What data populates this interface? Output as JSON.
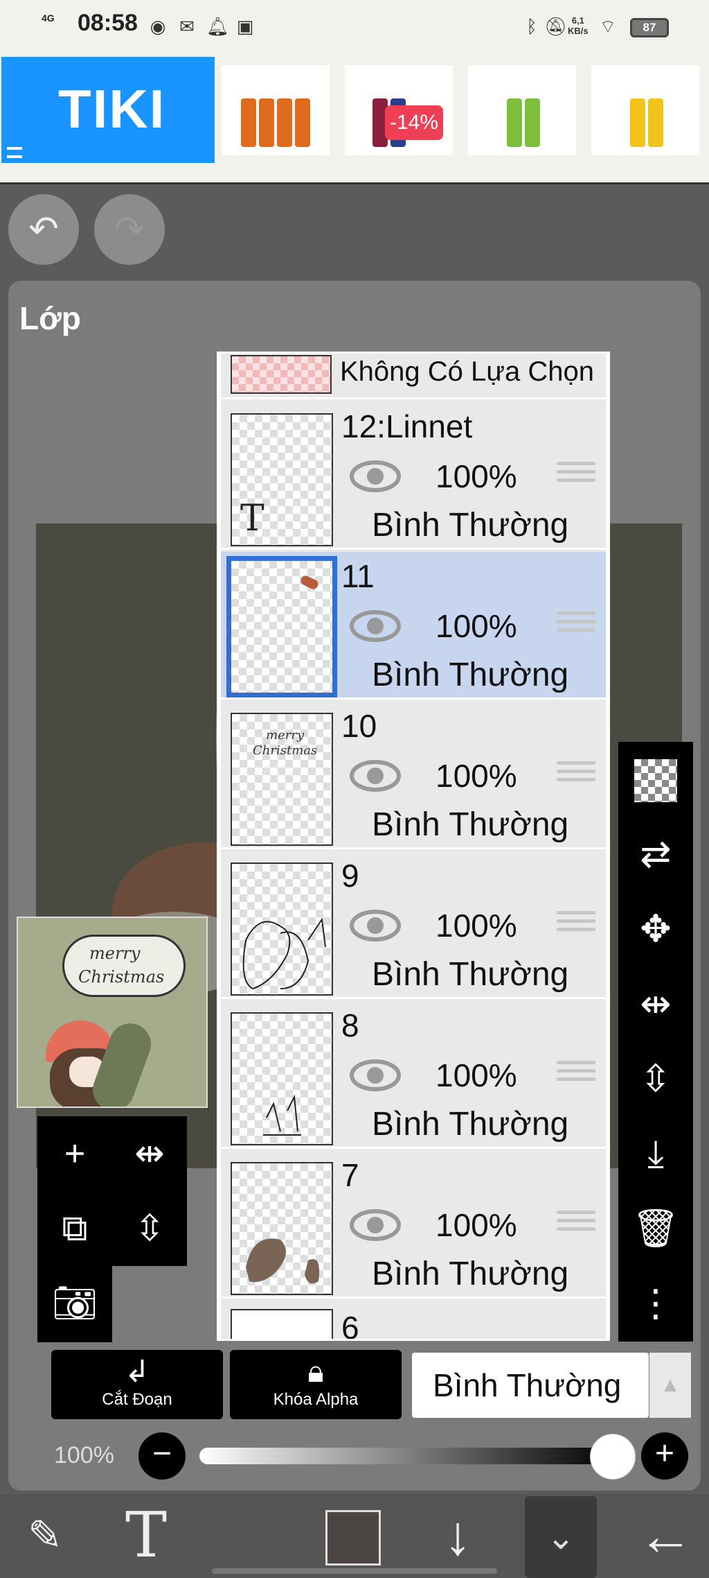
{
  "status_bar": {
    "time": "08:58",
    "network": "4G",
    "speed": "6,1\nKB/s",
    "battery": "87"
  },
  "ad": {
    "brand": "TIKI",
    "discount": "-14%"
  },
  "panel": {
    "title": "Lớp"
  },
  "layers": {
    "no_selection": "Không Có Lựa Chọn",
    "items": [
      {
        "name": "12:Linnet",
        "opacity": "100%",
        "mode": "Bình Thường"
      },
      {
        "name": "11",
        "opacity": "100%",
        "mode": "Bình Thường",
        "selected": true
      },
      {
        "name": "10",
        "opacity": "100%",
        "mode": "Bình Thường"
      },
      {
        "name": "9",
        "opacity": "100%",
        "mode": "Bình Thường"
      },
      {
        "name": "8",
        "opacity": "100%",
        "mode": "Bình Thường"
      },
      {
        "name": "7",
        "opacity": "100%",
        "mode": "Bình Thường"
      }
    ],
    "partial_layer": "6",
    "thumb_text_layer12": "T",
    "thumb_text_layer10": "merry\nChristmas"
  },
  "preview": {
    "line1": "merry",
    "line2": "Christmas"
  },
  "bottom": {
    "clipping_label": "Cắt Đoạn",
    "alpha_lock_label": "Khóa Alpha",
    "blend_mode": "Bình Thường",
    "opacity_label": "100%",
    "opacity_value": 1.0
  },
  "colors": {
    "accent": "#2f6fd6",
    "selected_row": "#c7d6ee",
    "tiki": "#1a94ff",
    "current_color": "#4b4643"
  }
}
